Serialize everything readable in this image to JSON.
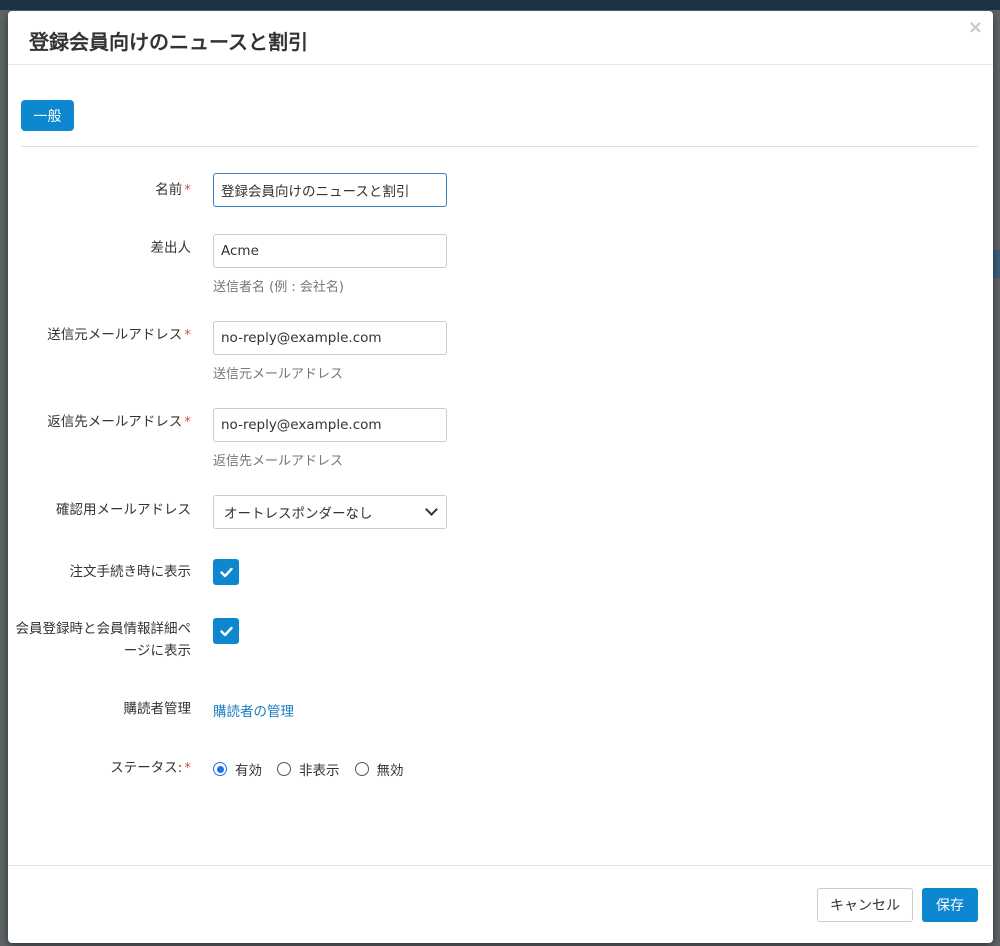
{
  "modal": {
    "title": "登録会員向けのニュースと割引",
    "close_symbol": "×"
  },
  "tabs": [
    {
      "label": "一般"
    }
  ],
  "form": {
    "name": {
      "label": "名前",
      "value": "登録会員向けのニュースと割引",
      "required_mark": "*"
    },
    "sender": {
      "label": "差出人",
      "value": "Acme",
      "help": "送信者名 (例 : 会社名)"
    },
    "from_email": {
      "label": "送信元メールアドレス",
      "value": "no-reply@example.com",
      "help": "送信元メールアドレス",
      "required_mark": "*"
    },
    "reply_email": {
      "label": "返信先メールアドレス",
      "value": "no-reply@example.com",
      "help": "返信先メールアドレス",
      "required_mark": "*"
    },
    "confirm_email": {
      "label": "確認用メールアドレス",
      "selected": "オートレスポンダーなし"
    },
    "show_checkout": {
      "label": "注文手続き時に表示",
      "checked": true
    },
    "show_profile": {
      "label": "会員登録時と会員情報詳細ページに表示",
      "checked": true
    },
    "subscribers": {
      "label": "購読者管理",
      "link": "購読者の管理"
    },
    "status": {
      "label": "ステータス:",
      "required_mark": "*",
      "options": [
        {
          "label": "有効",
          "checked": true
        },
        {
          "label": "非表示",
          "checked": false
        },
        {
          "label": "無効",
          "checked": false
        }
      ]
    }
  },
  "footer": {
    "cancel_label": "キャンセル",
    "save_label": "保存"
  },
  "colors": {
    "primary": "#0e87d1",
    "required": "#d9534f",
    "link": "#1a7dc4"
  }
}
